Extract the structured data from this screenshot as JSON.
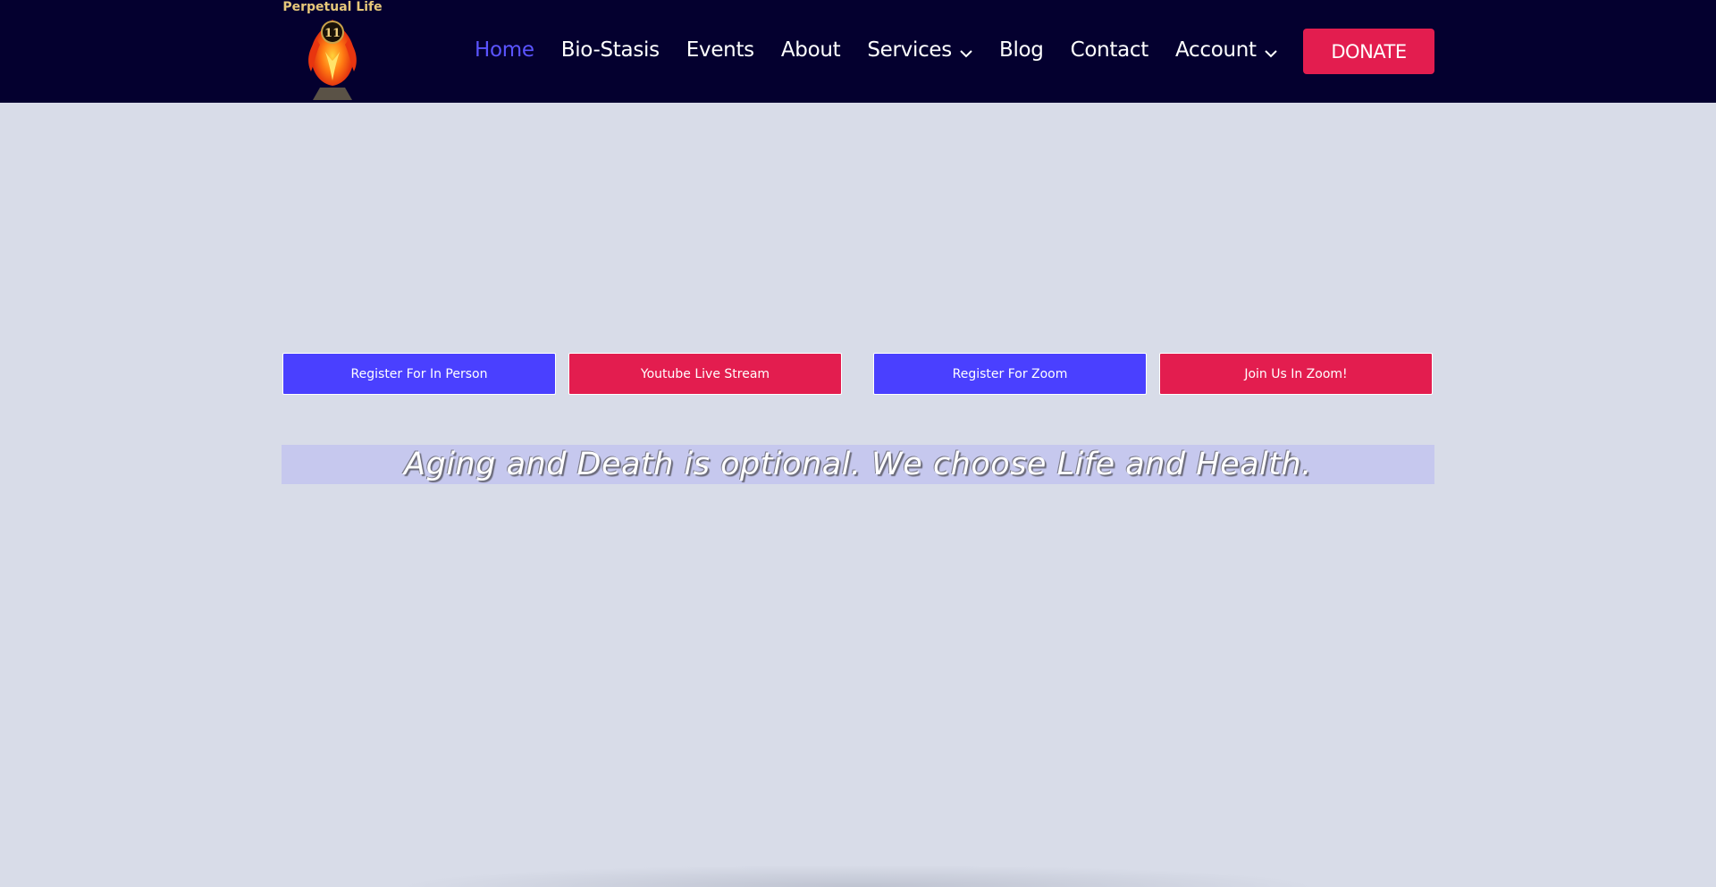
{
  "header": {
    "logo_text": "Perpetual Life",
    "logo_badge": "11",
    "nav": {
      "home": "Home",
      "biostasis": "Bio-Stasis",
      "events": "Events",
      "about": "About",
      "services": "Services",
      "blog": "Blog",
      "contact": "Contact",
      "account": "Account"
    },
    "donate_label": "DONATE"
  },
  "actions": {
    "register_in_person": "Register For In Person",
    "youtube_live": "Youtube Live Stream",
    "register_zoom": "Register For Zoom",
    "join_zoom": "Join Us In Zoom!"
  },
  "tagline": "Aging and Death is optional. We choose Life and Health.",
  "colors": {
    "header_bg": "#04002f",
    "page_bg": "#d8dce8",
    "accent_blue": "#4a40ff",
    "accent_red": "#e31d4f",
    "nav_active": "#5b54ff",
    "tagline_bg": "#c6c8ee"
  },
  "icons": {
    "logo": "phoenix-flame-logo-icon",
    "dropdown": "chevron-down-icon"
  }
}
